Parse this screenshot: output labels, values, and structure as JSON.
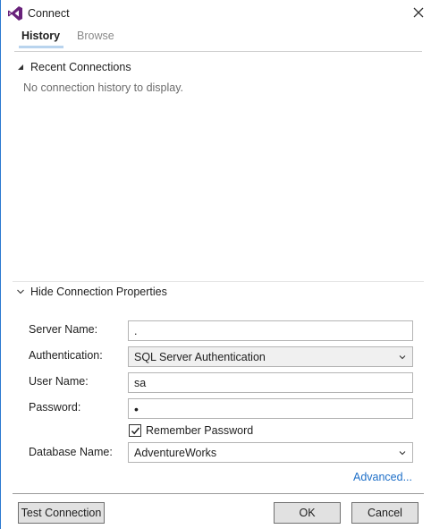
{
  "window": {
    "title": "Connect",
    "accent_color": "#68217a",
    "logo_icon": "visual-studio-icon",
    "close_icon": "close-icon"
  },
  "tabs": [
    {
      "label": "History",
      "active": true
    },
    {
      "label": "Browse",
      "active": false
    }
  ],
  "recent": {
    "header": "Recent Connections",
    "expanded": true,
    "empty_message": "No connection history to display."
  },
  "properties": {
    "header": "Hide Connection Properties",
    "server_name_label": "Server Name:",
    "server_name_value": ".",
    "authentication_label": "Authentication:",
    "authentication_value": "SQL Server Authentication",
    "user_name_label": "User Name:",
    "user_name_value": "sa",
    "password_label": "Password:",
    "password_value": "•",
    "remember_password_label": "Remember Password",
    "remember_password_checked": true,
    "database_name_label": "Database Name:",
    "database_name_value": "AdventureWorks",
    "advanced_link": "Advanced..."
  },
  "buttons": {
    "test_connection": "Test Connection",
    "ok": "OK",
    "cancel": "Cancel"
  }
}
